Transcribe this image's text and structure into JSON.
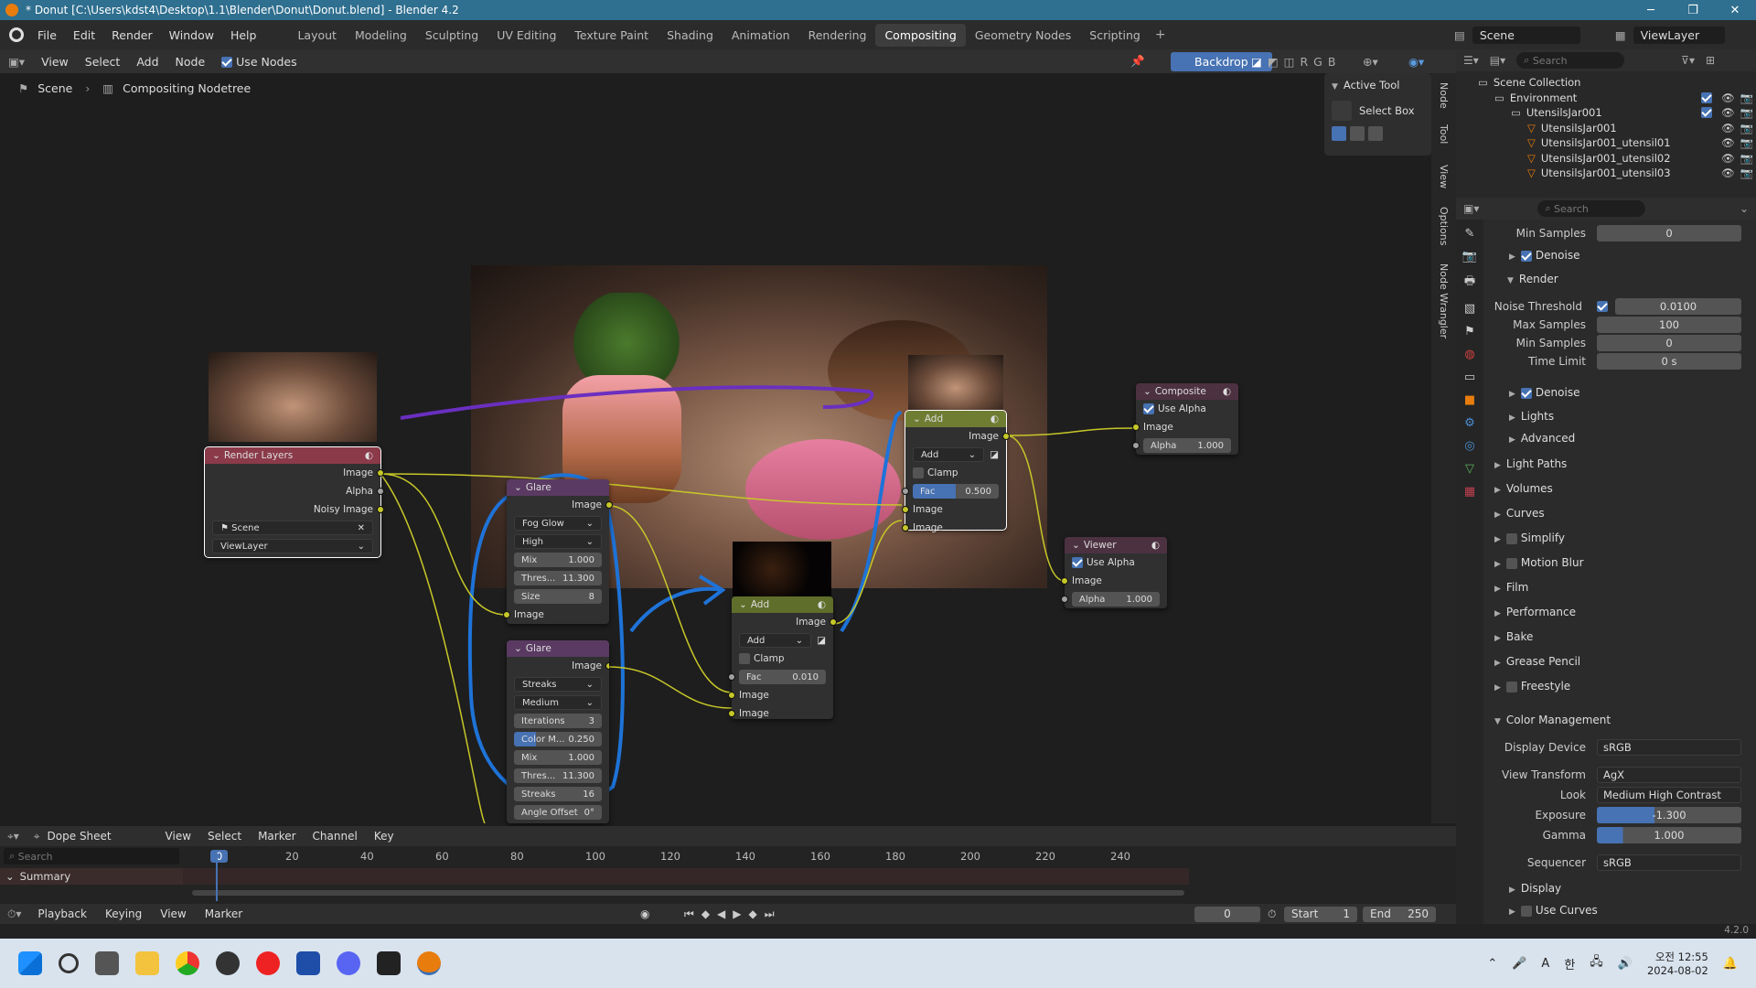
{
  "window": {
    "title": "* Donut [C:\\Users\\kdst4\\Desktop\\1.1\\Blender\\Donut\\Donut.blend] - Blender 4.2"
  },
  "menu": [
    "File",
    "Edit",
    "Render",
    "Window",
    "Help"
  ],
  "workspaces": [
    "Layout",
    "Modeling",
    "Sculpting",
    "UV Editing",
    "Texture Paint",
    "Shading",
    "Animation",
    "Rendering",
    "Compositing",
    "Geometry Nodes",
    "Scripting"
  ],
  "active_workspace": "Compositing",
  "scene_selector": {
    "scene": "Scene",
    "view_layer": "ViewLayer"
  },
  "node_header": {
    "view": "View",
    "select": "Select",
    "add": "Add",
    "node": "Node",
    "use_nodes": "Use Nodes",
    "backdrop": "Backdrop",
    "channels": [
      "R",
      "G",
      "B"
    ]
  },
  "breadcrumb": {
    "scene": "Scene",
    "tree": "Compositing Nodetree"
  },
  "active_tool": {
    "title": "Active Tool",
    "tool": "Select Box"
  },
  "side_tabs": [
    "Node",
    "Tool",
    "View",
    "Options",
    "Node Wrangler"
  ],
  "nodes": {
    "render_layers": {
      "title": "Render Layers",
      "outputs": [
        "Image",
        "Alpha",
        "Noisy Image"
      ],
      "scene": "Scene",
      "view_layer": "ViewLayer"
    },
    "glare1": {
      "title": "Glare",
      "output": "Image",
      "type": "Fog Glow",
      "quality": "High",
      "mix_label": "Mix",
      "mix": "1.000",
      "thres_label": "Thres...",
      "thres": "11.300",
      "size_label": "Size",
      "size": "8",
      "input": "Image"
    },
    "glare2": {
      "title": "Glare",
      "output": "Image",
      "type": "Streaks",
      "quality": "Medium",
      "iter_label": "Iterations",
      "iter": "3",
      "colm_label": "Color M...",
      "colm": "0.250",
      "mix_label": "Mix",
      "mix": "1.000",
      "thres_label": "Thres...",
      "thres": "11.300",
      "streaks_label": "Streaks",
      "streaks": "16",
      "angle_label": "Angle Offset",
      "angle": "0°"
    },
    "add1": {
      "title": "Add",
      "output": "Image",
      "op": "Add",
      "clamp": "Clamp",
      "fac_label": "Fac",
      "fac": "0.500",
      "in1": "Image",
      "in2": "Image"
    },
    "add2": {
      "title": "Add",
      "output": "Image",
      "op": "Add",
      "clamp": "Clamp",
      "fac_label": "Fac",
      "fac": "0.010",
      "in1": "Image",
      "in2": "Image"
    },
    "composite": {
      "title": "Composite",
      "use_alpha": "Use Alpha",
      "input": "Image",
      "alpha_label": "Alpha",
      "alpha": "1.000"
    },
    "viewer": {
      "title": "Viewer",
      "use_alpha": "Use Alpha",
      "input": "Image",
      "alpha_label": "Alpha",
      "alpha": "1.000"
    }
  },
  "outliner": {
    "search_placeholder": "Search",
    "items": [
      {
        "label": "Scene Collection",
        "depth": 0
      },
      {
        "label": "Environment",
        "depth": 1
      },
      {
        "label": "UtensilsJar001",
        "depth": 2
      },
      {
        "label": "UtensilsJar001",
        "depth": 3
      },
      {
        "label": "UtensilsJar001_utensil01",
        "depth": 3
      },
      {
        "label": "UtensilsJar001_utensil02",
        "depth": 3
      },
      {
        "label": "UtensilsJar001_utensil03",
        "depth": 3
      }
    ]
  },
  "properties": {
    "search_placeholder": "Search",
    "min_samples_top": {
      "label": "Min Samples",
      "value": "0"
    },
    "denoise1": "Denoise",
    "render": "Render",
    "noise_threshold": {
      "label": "Noise Threshold",
      "value": "0.0100"
    },
    "max_samples": {
      "label": "Max Samples",
      "value": "100"
    },
    "min_samples": {
      "label": "Min Samples",
      "value": "0"
    },
    "time_limit": {
      "label": "Time Limit",
      "value": "0 s"
    },
    "denoise2": "Denoise",
    "lights": "Lights",
    "advanced": "Advanced",
    "sections": [
      "Light Paths",
      "Volumes",
      "Curves",
      "Simplify",
      "Motion Blur",
      "Film",
      "Performance",
      "Bake",
      "Grease Pencil",
      "Freestyle"
    ],
    "color_management": "Color Management",
    "display_device": {
      "label": "Display Device",
      "value": "sRGB"
    },
    "view_transform": {
      "label": "View Transform",
      "value": "AgX"
    },
    "look": {
      "label": "Look",
      "value": "Medium High Contrast"
    },
    "exposure": {
      "label": "Exposure",
      "value": "-1.300",
      "fill": 0.4
    },
    "gamma": {
      "label": "Gamma",
      "value": "1.000",
      "fill": 0.18
    },
    "sequencer": {
      "label": "Sequencer",
      "value": "sRGB"
    },
    "display": "Display",
    "use_curves": "Use Curves"
  },
  "timeline": {
    "editor": "Dope Sheet",
    "menus": [
      "View",
      "Select",
      "Marker",
      "Channel",
      "Key"
    ],
    "search_placeholder": "Search",
    "summary": "Summary",
    "frames": [
      "0",
      "20",
      "40",
      "60",
      "80",
      "100",
      "120",
      "140",
      "160",
      "180",
      "200",
      "220",
      "240"
    ],
    "current": "0",
    "playback": "Playback",
    "keying": "Keying",
    "view": "View",
    "marker": "Marker",
    "frame_value": "0",
    "start_label": "Start",
    "start": "1",
    "end_label": "End",
    "end": "250"
  },
  "status": {
    "version": "4.2.0"
  },
  "taskbar": {
    "time": "오전 12:55",
    "date": "2024-08-02",
    "ime": "A",
    "ime2": "한"
  }
}
